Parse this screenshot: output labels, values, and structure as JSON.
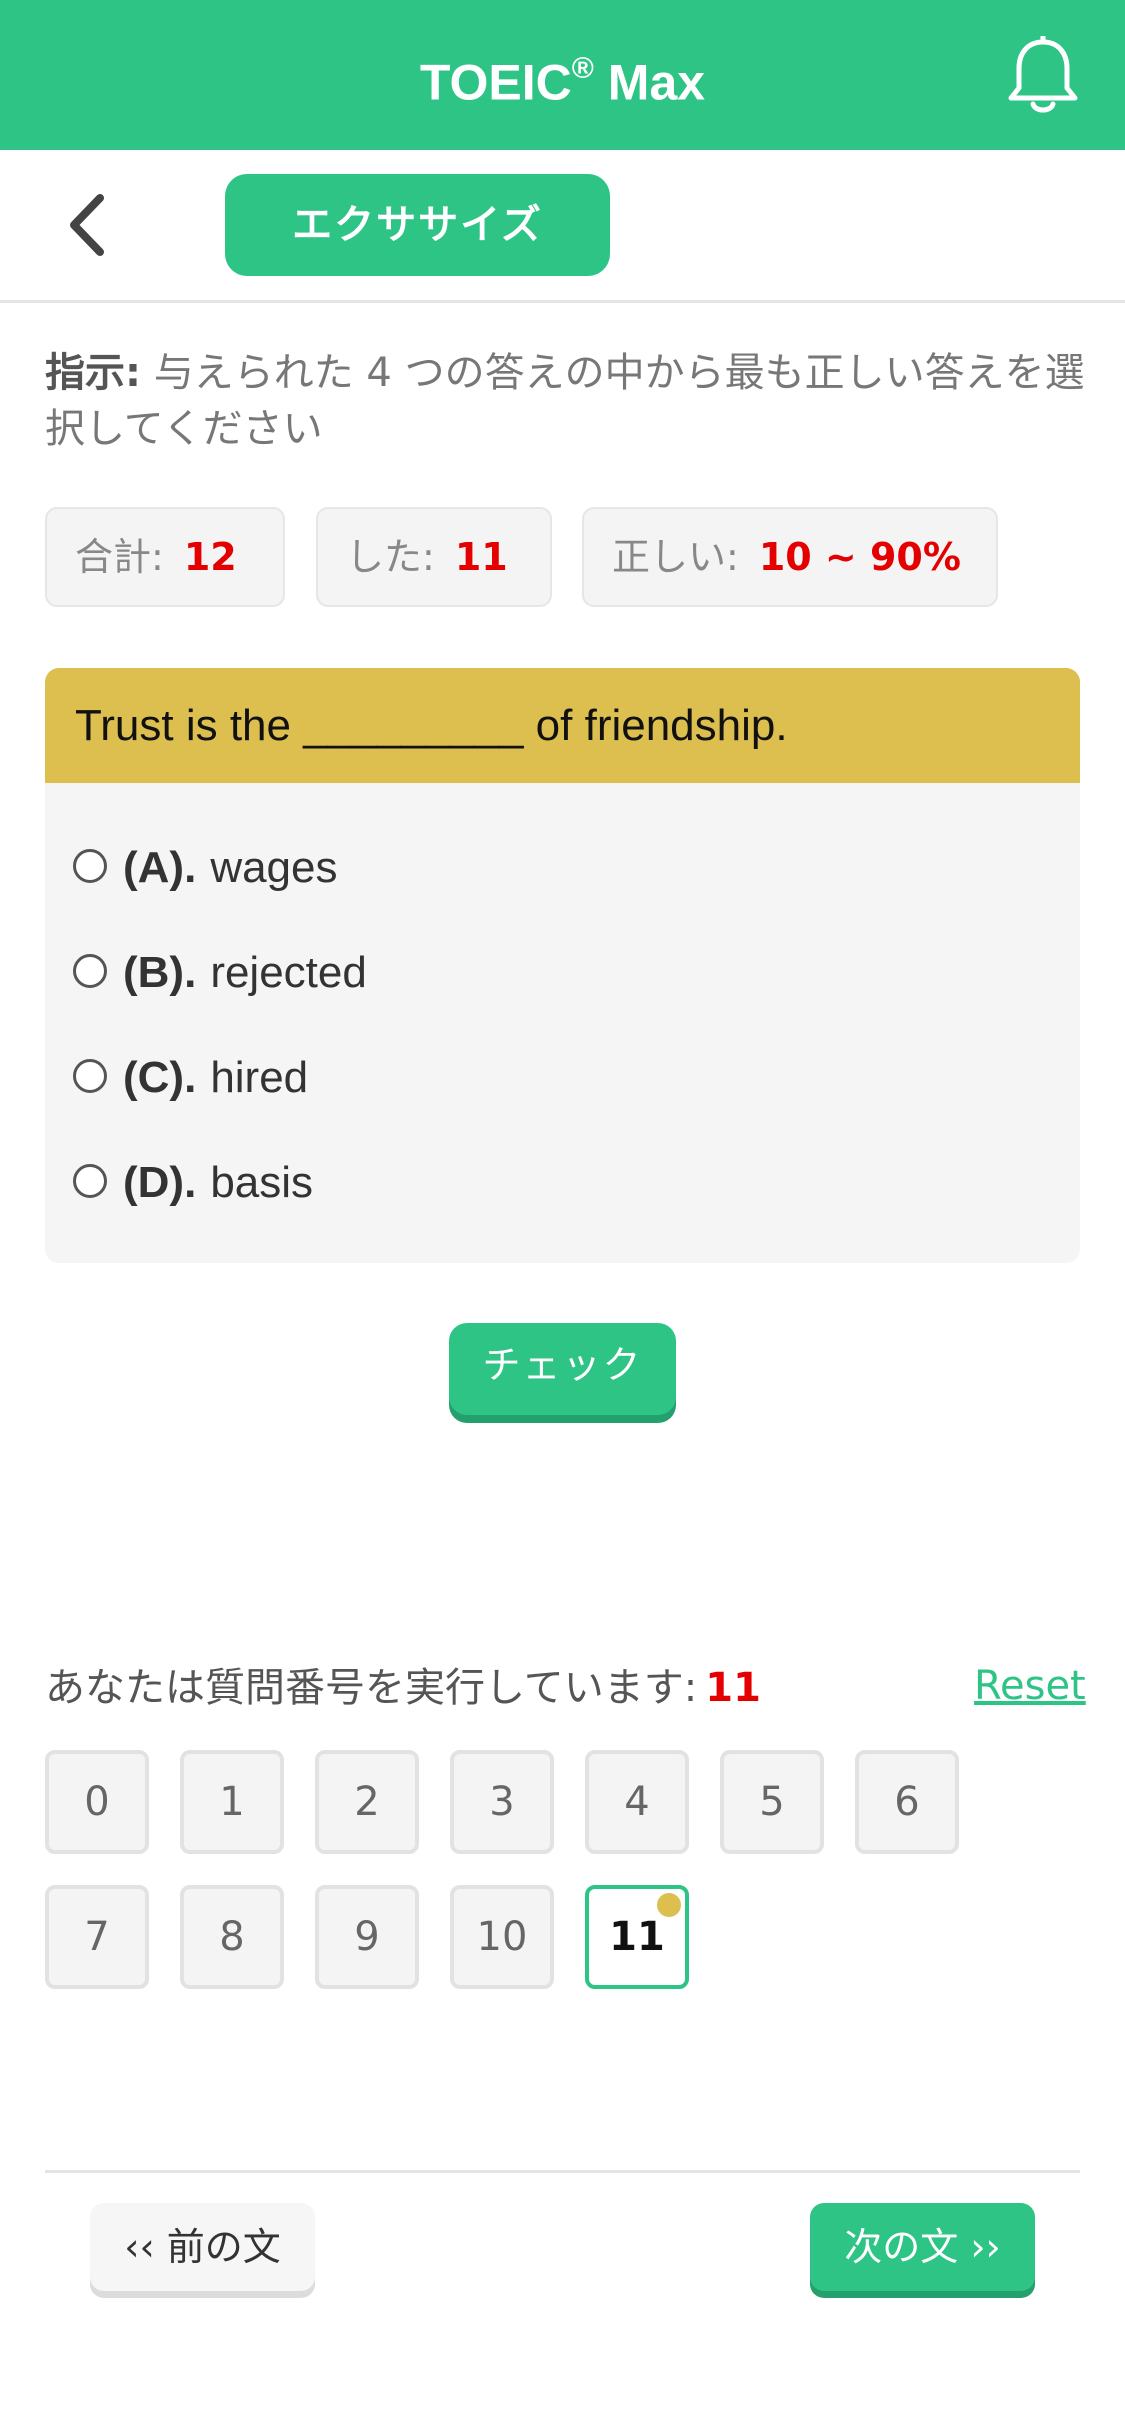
{
  "header": {
    "title": "TOEIC",
    "title_mark": "®",
    "title_suffix": " Max",
    "bell_icon": "bell-icon"
  },
  "nav": {
    "back_icon": "chevron-left-icon",
    "tab_label": "エクササイズ"
  },
  "instruction": {
    "label": "指示:",
    "text": " 与えられた 4 つの答えの中から最も正しい答えを選択してください"
  },
  "stats": {
    "total_label": "合計:",
    "total_value": "12",
    "done_label": "した:",
    "done_value": "11",
    "correct_label": "正しい:",
    "correct_value": "10 ~ 90%"
  },
  "question": {
    "text": "Trust is the _________ of friendship.",
    "options": [
      {
        "letter": "(A).",
        "text": "wages"
      },
      {
        "letter": "(B).",
        "text": "rejected"
      },
      {
        "letter": "(C).",
        "text": "hired"
      },
      {
        "letter": "(D).",
        "text": "basis"
      }
    ],
    "check_label": "チェック"
  },
  "progress": {
    "label": "あなたは質問番号を実行しています:",
    "current": "11",
    "reset_label": "Reset",
    "numbers": [
      "0",
      "1",
      "2",
      "3",
      "4",
      "5",
      "6",
      "7",
      "8",
      "9",
      "10",
      "11"
    ]
  },
  "footer": {
    "prev_label": "‹‹ 前の文",
    "next_label": "次の文 ››"
  },
  "colors": {
    "accent": "#2ec486",
    "question_header": "#dcbf4f",
    "highlight": "#e40000"
  }
}
